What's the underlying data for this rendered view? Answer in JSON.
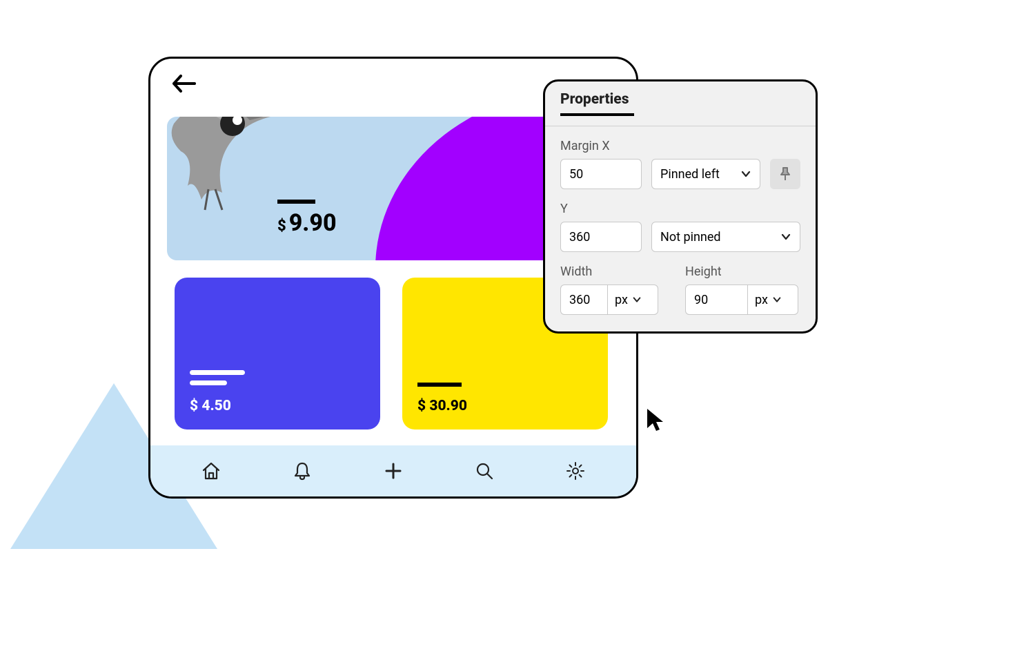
{
  "app": {
    "hero_price": "9.90",
    "currency": "$",
    "card_left_price": "$ 4.50",
    "card_right_price": "$ 30.90"
  },
  "nav": {
    "home": "home-icon",
    "bell": "bell-icon",
    "plus": "plus-icon",
    "search": "search-icon",
    "settings": "gear-icon"
  },
  "panel": {
    "title": "Properties",
    "margin_x_label": "Margin X",
    "margin_x_value": "50",
    "margin_x_pin": "Pinned left",
    "y_label": "Y",
    "y_value": "360",
    "y_pin": "Not pinned",
    "width_label": "Width",
    "width_value": "360",
    "width_unit": "px",
    "height_label": "Height",
    "height_value": "90",
    "height_unit": "px"
  }
}
